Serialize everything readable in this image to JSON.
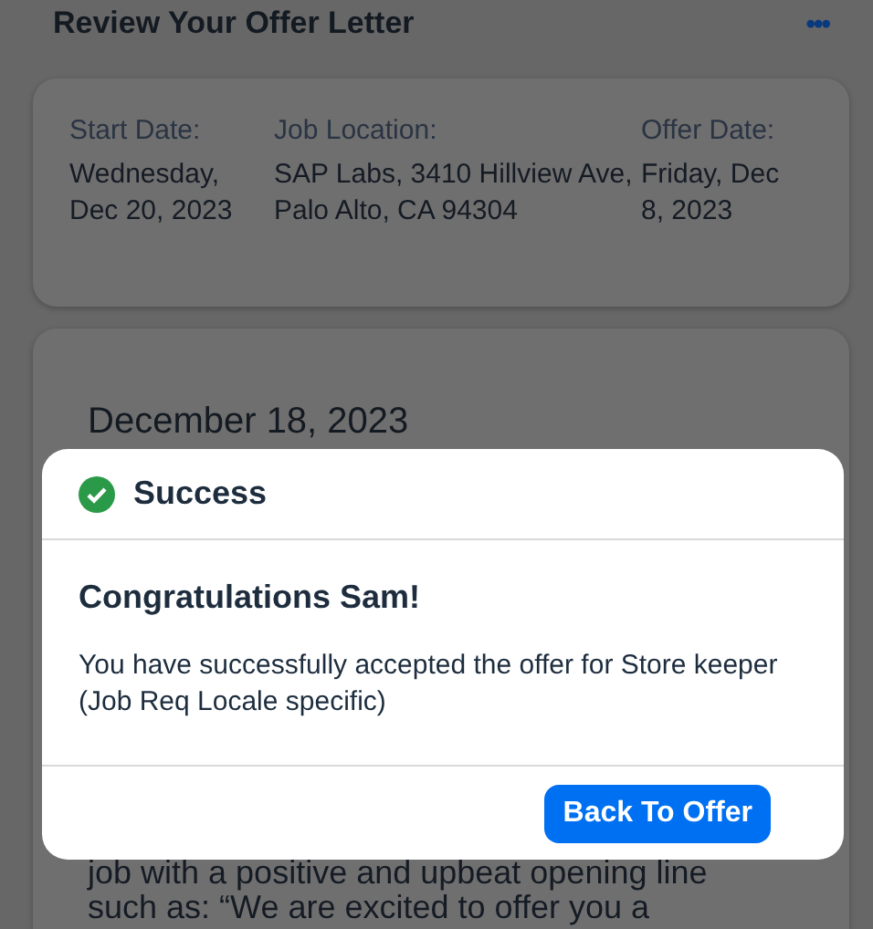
{
  "header": {
    "title": "Review Your Offer Letter",
    "menu": "•••"
  },
  "summary": [
    {
      "label": "Start Date:",
      "value": "Wednesday, Dec 20, 2023"
    },
    {
      "label": "Job Location:",
      "value": "SAP Labs, 3410 Hillview Ave, Palo Alto, CA 94304"
    },
    {
      "label": "Offer Date:",
      "value": "Friday, Dec 8, 2023"
    }
  ],
  "letter": {
    "date": "December 18, 2023",
    "lines": [
      "job with a positive and upbeat opening line",
      "such as: “We are excited to offer you a"
    ]
  },
  "dialog": {
    "title": "Success",
    "heading": "Congratulations Sam!",
    "message": "You have successfully accepted the offer for Store keeper (Job Req Locale specific)",
    "button": "Back To Offer"
  }
}
